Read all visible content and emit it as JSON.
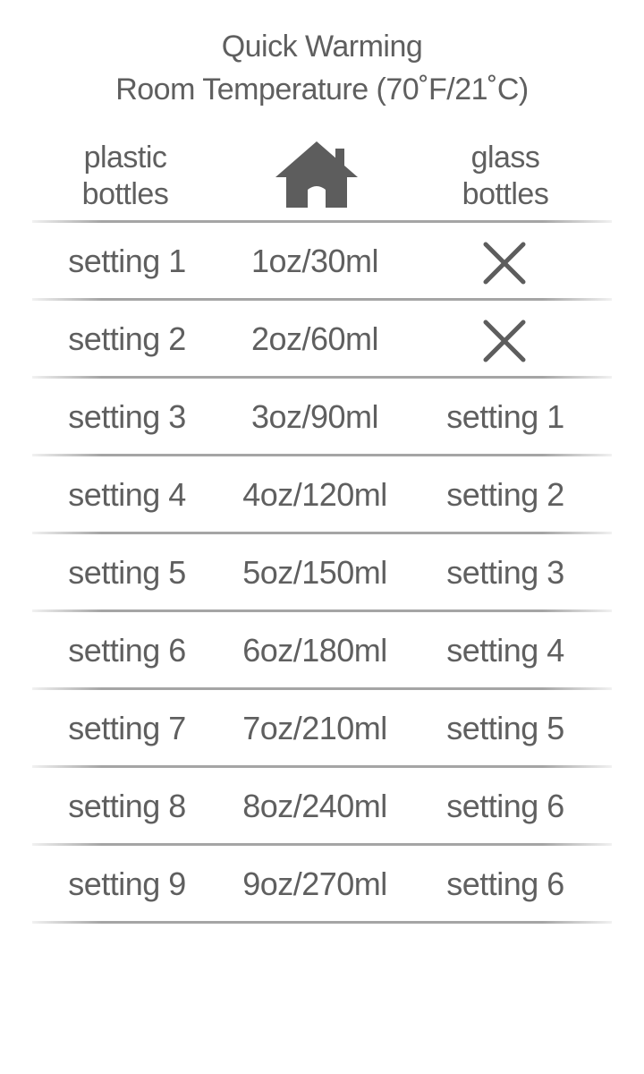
{
  "title": {
    "line1": "Quick Warming",
    "line2": "Room Temperature (70˚F/21˚C)"
  },
  "header": {
    "left_line1": "plastic",
    "left_line2": "bottles",
    "center_icon": "house-icon",
    "right_line1": "glass",
    "right_line2": "bottles"
  },
  "not_applicable_icon": "x-icon",
  "colors": {
    "text": "#5f5f5f",
    "icon": "#5d5d5d",
    "rule": "#a5a5a5"
  },
  "rows": [
    {
      "plastic": "setting 1",
      "volume": "1oz/30ml",
      "glass": null
    },
    {
      "plastic": "setting 2",
      "volume": "2oz/60ml",
      "glass": null
    },
    {
      "plastic": "setting 3",
      "volume": "3oz/90ml",
      "glass": "setting 1"
    },
    {
      "plastic": "setting 4",
      "volume": "4oz/120ml",
      "glass": "setting 2"
    },
    {
      "plastic": "setting 5",
      "volume": "5oz/150ml",
      "glass": "setting 3"
    },
    {
      "plastic": "setting 6",
      "volume": "6oz/180ml",
      "glass": "setting 4"
    },
    {
      "plastic": "setting 7",
      "volume": "7oz/210ml",
      "glass": "setting 5"
    },
    {
      "plastic": "setting 8",
      "volume": "8oz/240ml",
      "glass": "setting 6"
    },
    {
      "plastic": "setting 9",
      "volume": "9oz/270ml",
      "glass": "setting 6"
    }
  ]
}
